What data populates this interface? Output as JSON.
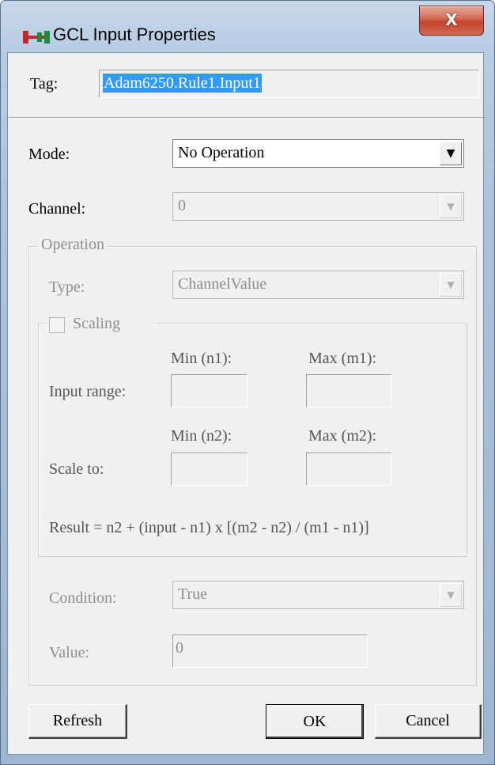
{
  "window": {
    "title": "GCL Input Properties",
    "close_glyph": "X",
    "icon": "gcl-app-icon"
  },
  "tag": {
    "label": "Tag:",
    "value": "Adam6250.Rule1.Input1"
  },
  "mode": {
    "label": "Mode:",
    "value": "No Operation"
  },
  "channel": {
    "label": "Channel:",
    "value": "0"
  },
  "operation": {
    "caption": "Operation",
    "type_label": "Type:",
    "type_value": "ChannelValue",
    "scaling": {
      "label": "Scaling",
      "checked": false,
      "min_n1_label": "Min (n1):",
      "max_m1_label": "Max (m1):",
      "input_range_label": "Input range:",
      "min_n2_label": "Min (n2):",
      "max_m2_label": "Max (m2):",
      "scale_to_label": "Scale to:",
      "formula": "Result = n2 + (input - n1) x [(m2 - n2) / (m1 - n1)]"
    },
    "condition_label": "Condition:",
    "condition_value": "True",
    "value_label": "Value:",
    "value_value": "0"
  },
  "buttons": {
    "refresh": "Refresh",
    "ok": "OK",
    "cancel": "Cancel"
  },
  "colors": {
    "selection": "#3399ff",
    "close_button": "#c5452d",
    "disabled_text": "#8e8e8e"
  }
}
